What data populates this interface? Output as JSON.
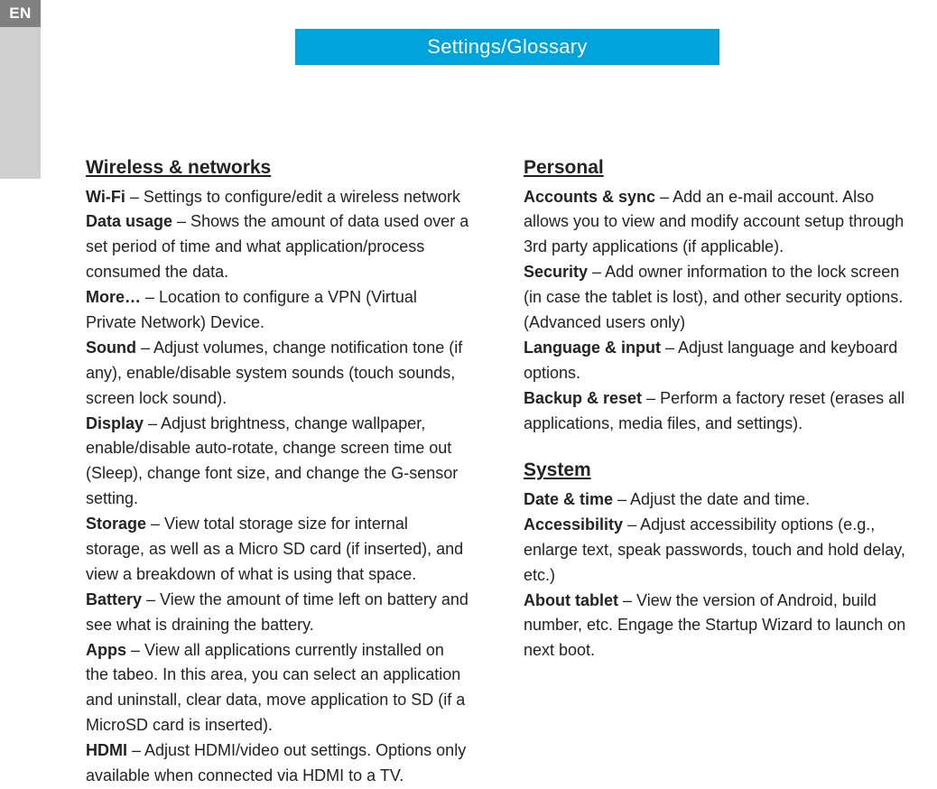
{
  "lang_tag": "EN",
  "title": "Settings/Glossary",
  "left": {
    "section1": {
      "heading": "Wireless & networks",
      "wifi_label": "Wi-Fi",
      "wifi_text": " – Settings to configure/edit a wireless network",
      "data_usage_label": "Data usage",
      "data_usage_text": " – Shows the amount of data used over a set period of time and what application/process consumed the data.",
      "more_label": "More…",
      "more_text": " – Location to configure a VPN (Virtual Private Network) Device.",
      "sound_label": "Sound",
      "sound_text": " – Adjust volumes, change notification tone (if any), enable/disable system sounds (touch sounds, screen lock sound).",
      "display_label": "Display",
      "display_text": " – Adjust brightness, change wallpaper, enable/disable auto-rotate, change screen time out (Sleep), change font size, and change the G-sensor setting.",
      "storage_label": "Storage",
      "storage_text": " – View total storage size for internal storage, as well as a Micro SD card (if inserted), and view a breakdown of what is using that space.",
      "battery_label": "Battery",
      "battery_text": " – View the amount of time left on battery and see what is draining the battery.",
      "apps_label": "Apps",
      "apps_text": " – View all applications currently installed on the tabeo. In this area, you can select an application and uninstall, clear data, move application to SD (if a MicroSD card is inserted).",
      "hdmi_label": "HDMI",
      "hdmi_text": " – Adjust HDMI/video out settings. Options only available when connected via HDMI to a TV."
    }
  },
  "right": {
    "section1": {
      "heading": "Personal",
      "accounts_label": "Accounts & sync",
      "accounts_text": " – Add an e-mail account. Also allows you to view and modify account setup through 3rd party applications (if applicable).",
      "security_label": "Security",
      "security_text": " – Add owner information to the lock screen (in case the tablet is lost), and other security options. (Advanced users only)",
      "language_label": "Language & input",
      "language_text": " – Adjust language and keyboard options.",
      "backup_label": "Backup & reset",
      "backup_text": " – Perform a factory reset (erases all applications, media files, and settings)."
    },
    "section2": {
      "heading": "System",
      "date_label": "Date & time",
      "date_text": " – Adjust the date and time.",
      "access_label": "Accessibility",
      "access_text": " – Adjust accessibility options (e.g., enlarge text, speak passwords, touch and hold delay, etc.)",
      "about_label": "About tablet",
      "about_text": " – View the version of Android, build number, etc. Engage the Startup Wizard to launch on next boot."
    }
  }
}
